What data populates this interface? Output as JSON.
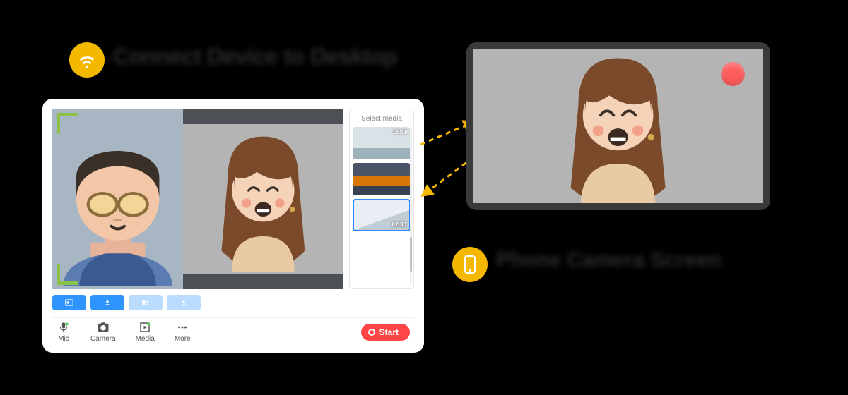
{
  "labels": {
    "desktop_heading": "Connect Device to Desktop",
    "phone_heading": "Phone Camera Screen"
  },
  "desktop": {
    "media_panel": {
      "title": "Select media",
      "thumbs": [
        {
          "duration": "05:00"
        },
        {
          "duration": ""
        },
        {
          "duration": "02:30"
        }
      ]
    },
    "toolbar": {
      "mic": "Mic",
      "camera": "Camera",
      "media": "Media",
      "more": "More",
      "start": "Start"
    }
  },
  "icons": {
    "wifi": "wifi-icon",
    "phone": "phone-icon",
    "record": "record-icon"
  }
}
